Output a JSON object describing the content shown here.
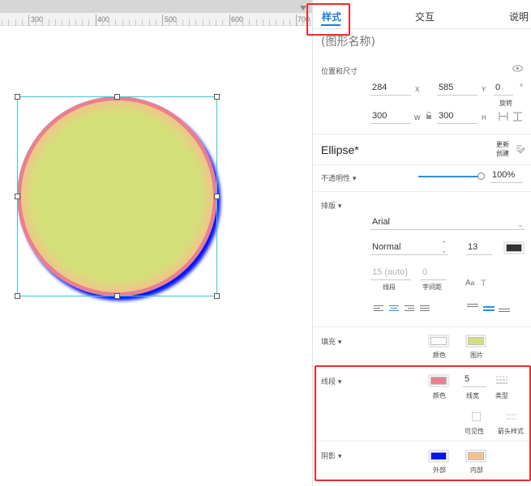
{
  "ruler": {
    "labels": [
      "300",
      "400",
      "500",
      "600",
      "700"
    ]
  },
  "tabs": [
    "样式",
    "交互",
    "说明"
  ],
  "shape_name_placeholder": "(图形名称)",
  "position_size": {
    "section_label": "位置和尺寸",
    "x": "284",
    "x_unit": "X",
    "y": "585",
    "y_unit": "Y",
    "rotation": "0",
    "rotation_unit": "°",
    "rotation_label": "旋转",
    "w": "300",
    "w_unit": "W",
    "h": "300",
    "h_unit": "H"
  },
  "style_name": "Ellipse*",
  "update_label": "更新",
  "create_label": "创建",
  "opacity": {
    "label": "不透明性 ▾",
    "value": "100%",
    "level": 1.0
  },
  "typography": {
    "section_label": "排版 ▾",
    "font": "Arial",
    "weight": "Normal",
    "size": "13",
    "text_color": "#333333",
    "line_height": "15 (auto)",
    "line_height_label": "线段",
    "letter_spacing": "0",
    "letter_spacing_label": "字间距"
  },
  "fill": {
    "section_label": "填充 ▾",
    "color_label": "颜色",
    "image_label": "图片",
    "color": "#ffffff",
    "image_color": "#d3e07a"
  },
  "stroke": {
    "section_label": "线段 ▾",
    "color": "#e9808f",
    "color_label": "颜色",
    "width": "5",
    "width_label": "线宽",
    "type_label": "类型",
    "visibility_label": "可见性",
    "arrow_label": "箭头样式"
  },
  "shadow": {
    "section_label": "阴影 ▾",
    "outer_color": "#0014ff",
    "outer_label": "外部",
    "inner_color": "#f6c08d",
    "inner_label": "内部"
  },
  "colors": {
    "accent": "#1a7bd6",
    "highlight": "#ef2929",
    "selection": "#35c6d4"
  }
}
